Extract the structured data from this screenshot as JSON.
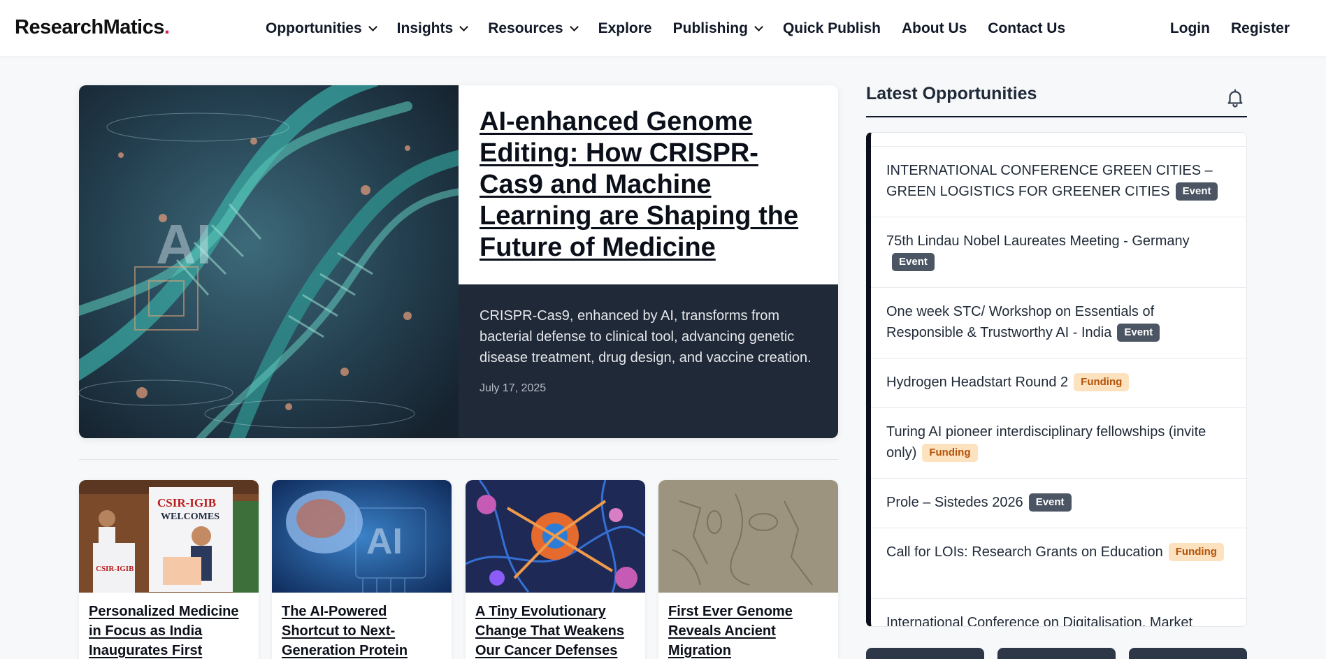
{
  "brand": {
    "name": "ResearchMatics",
    "dot": "."
  },
  "nav": [
    {
      "label": "Opportunities",
      "dropdown": true
    },
    {
      "label": "Insights",
      "dropdown": true
    },
    {
      "label": "Resources",
      "dropdown": true
    },
    {
      "label": "Explore",
      "dropdown": false
    },
    {
      "label": "Publishing",
      "dropdown": true
    },
    {
      "label": "Quick Publish",
      "dropdown": false
    },
    {
      "label": "About Us",
      "dropdown": false
    },
    {
      "label": "Contact Us",
      "dropdown": false
    }
  ],
  "auth": {
    "login": "Login",
    "register": "Register"
  },
  "hero": {
    "title": "AI-enhanced Genome Editing: How CRISPR-Cas9 and Machine Learning are Shaping the Future of Medicine",
    "description": "CRISPR-Cas9, enhanced by AI, transforms from bacterial defense to clinical tool, advancing genetic disease treatment, drug design, and vaccine creation.",
    "date": "July 17, 2025",
    "image_text": "AI"
  },
  "cards": [
    {
      "title": "Personalized Medicine in Focus as India Inaugurates First",
      "image_text_1": "CSIR-IGIB",
      "image_text_2": "WELCOMES"
    },
    {
      "title": "The AI-Powered Shortcut to Next-Generation Protein",
      "image_text_1": "AI"
    },
    {
      "title": "A Tiny Evolutionary Change That Weakens Our Cancer Defenses"
    },
    {
      "title": "First Ever Genome Reveals Ancient Migration"
    }
  ],
  "sidebar": {
    "title": "Latest Opportunities",
    "items": [
      {
        "title": "INTERNATIONAL CONFERENCE GREEN CITIES – GREEN LOGISTICS FOR GREENER CITIES",
        "badge": "Event",
        "type": "event"
      },
      {
        "title": "75th Lindau Nobel Laureates Meeting - Germany",
        "badge": "Event",
        "type": "event"
      },
      {
        "title": "One week STC/ Workshop on Essentials of Responsible & Trustworthy AI - India",
        "badge": "Event",
        "type": "event"
      },
      {
        "title": "Hydrogen Headstart Round 2",
        "badge": "Funding",
        "type": "funding"
      },
      {
        "title": "Turing AI pioneer interdisciplinary fellowships (invite only)",
        "badge": "Funding",
        "type": "funding"
      },
      {
        "title": "Prole – Sistedes 2026",
        "badge": "Event",
        "type": "event"
      },
      {
        "title": "Call for LOIs: Research Grants on Education",
        "badge": "Funding",
        "type": "funding"
      },
      {
        "title": "International Conference on Digitalisation, Market",
        "badge": "",
        "type": ""
      }
    ]
  },
  "colors": {
    "accent_dot": "#e11d48",
    "dark_panel": "#1f2937",
    "event_badge": "#4b5563",
    "funding_badge": "#fde2c0"
  }
}
